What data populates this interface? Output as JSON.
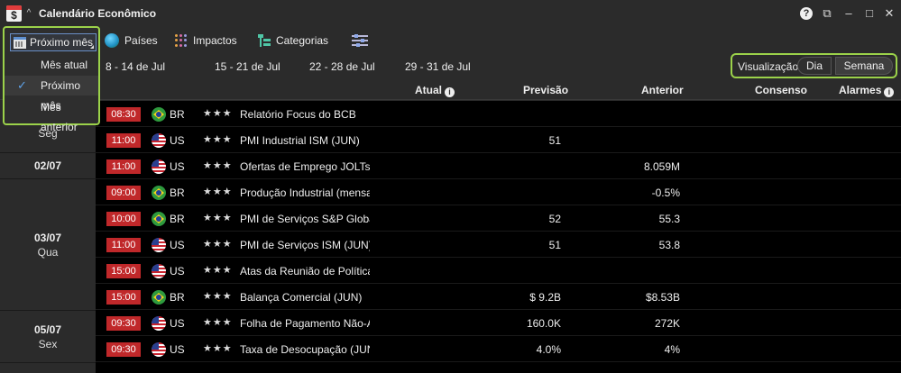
{
  "window": {
    "title": "Calendário Econômico",
    "help": "?",
    "popout": "⧉",
    "minimize": "–",
    "maximize": "□",
    "close": "✕"
  },
  "toolbar": {
    "period_selected": "Próximo mês",
    "countries_label": "Países",
    "impacts_label": "Impactos",
    "categories_label": "Categorias"
  },
  "period_menu": {
    "items": [
      "Mês atual",
      "Próximo mês",
      "Mês anterior"
    ],
    "selected_index": 1
  },
  "periods": [
    "8 - 14 de Jul",
    "15 - 21 de Jul",
    "22 - 28 de Jul",
    "29 - 31 de Jul"
  ],
  "visualization": {
    "label": "Visualização:",
    "options": [
      "Dia",
      "Semana"
    ],
    "selected": "Semana"
  },
  "columns": {
    "actual": "Atual",
    "forecast": "Previsão",
    "previous": "Anterior",
    "consensus": "Consenso",
    "alarms": "Alarmes"
  },
  "date_groups": [
    {
      "date": "",
      "weekday": "Seg"
    },
    {
      "date": "02/07",
      "weekday": ""
    },
    {
      "date": "03/07",
      "weekday": "Qua"
    },
    {
      "date": "05/07",
      "weekday": "Sex"
    }
  ],
  "rows": [
    {
      "time": "08:30",
      "flag": "br",
      "country": "BR",
      "stars": "★★★",
      "event": "Relatório Focus do BCB",
      "forecast": "",
      "previous": ""
    },
    {
      "time": "11:00",
      "flag": "us",
      "country": "US",
      "stars": "★★★",
      "event": "PMI Industrial ISM (JUN)",
      "forecast": "51",
      "previous": ""
    },
    {
      "time": "11:00",
      "flag": "us",
      "country": "US",
      "stars": "★★★",
      "event": "Ofertas de Emprego JOLTs (MAI)",
      "forecast": "",
      "previous": "8.059M"
    },
    {
      "time": "09:00",
      "flag": "br",
      "country": "BR",
      "stars": "★★★",
      "event": "Produção Industrial (mensal)",
      "forecast": "",
      "previous": "-0.5%"
    },
    {
      "time": "10:00",
      "flag": "br",
      "country": "BR",
      "stars": "★★★",
      "event": "PMI de Serviços S&P Global",
      "forecast": "52",
      "previous": "55.3"
    },
    {
      "time": "11:00",
      "flag": "us",
      "country": "US",
      "stars": "★★★",
      "event": "PMI de Serviços ISM (JUN)",
      "forecast": "51",
      "previous": "53.8"
    },
    {
      "time": "15:00",
      "flag": "us",
      "country": "US",
      "stars": "★★★",
      "event": "Atas da Reunião de Política Monetária",
      "forecast": "",
      "previous": ""
    },
    {
      "time": "15:00",
      "flag": "br",
      "country": "BR",
      "stars": "★★★",
      "event": "Balança Comercial (JUN)",
      "forecast": "$ 9.2B",
      "previous": "$8.53B"
    },
    {
      "time": "09:30",
      "flag": "us",
      "country": "US",
      "stars": "★★★",
      "event": "Folha de Pagamento Não-Agrícola",
      "forecast": "160.0K",
      "previous": "272K"
    },
    {
      "time": "09:30",
      "flag": "us",
      "country": "US",
      "stars": "★★★",
      "event": "Taxa de Desocupação (JUN)",
      "forecast": "4.0%",
      "previous": "4%"
    }
  ]
}
